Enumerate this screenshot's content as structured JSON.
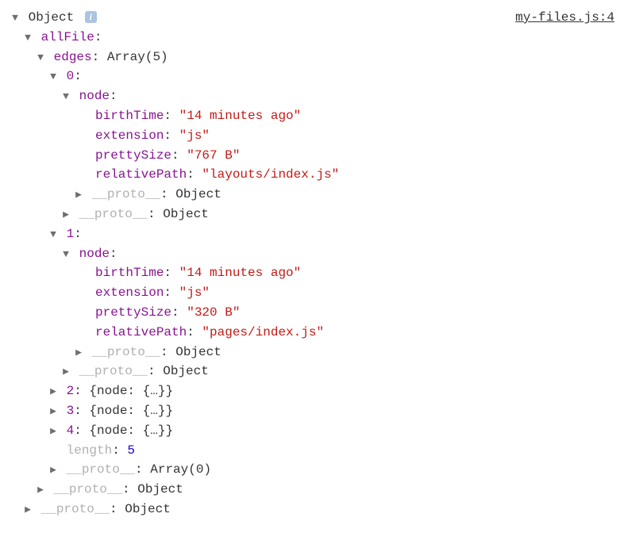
{
  "source_link": "my-files.js:4",
  "root_label": "Object",
  "keys": {
    "allFile": "allFile",
    "edges": "edges",
    "node": "node",
    "birthTime": "birthTime",
    "extension": "extension",
    "prettySize": "prettySize",
    "relativePath": "relativePath",
    "length": "length",
    "proto": "__proto__"
  },
  "edges_type": "Array(5)",
  "collapsed_node": "{node: {…}}",
  "proto_object": "Object",
  "proto_array": "Array(0)",
  "edges": [
    {
      "index": "0",
      "birthTime": "\"14 minutes ago\"",
      "extension": "\"js\"",
      "prettySize": "\"767 B\"",
      "relativePath": "\"layouts/index.js\""
    },
    {
      "index": "1",
      "birthTime": "\"14 minutes ago\"",
      "extension": "\"js\"",
      "prettySize": "\"320 B\"",
      "relativePath": "\"pages/index.js\""
    },
    {
      "index": "2"
    },
    {
      "index": "3"
    },
    {
      "index": "4"
    }
  ],
  "length_value": "5"
}
